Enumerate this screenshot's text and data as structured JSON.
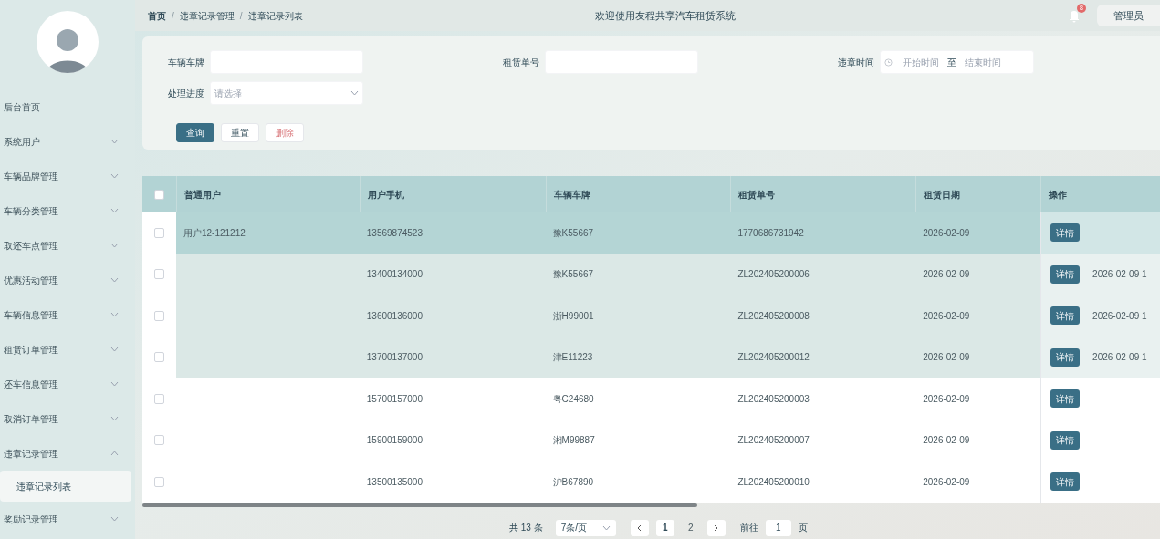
{
  "sidebar": {
    "items": [
      {
        "label": "后台首页",
        "has_children": false
      },
      {
        "label": "系统用户",
        "has_children": true,
        "expanded": false
      },
      {
        "label": "车辆品牌管理",
        "has_children": true,
        "expanded": false
      },
      {
        "label": "车辆分类管理",
        "has_children": true,
        "expanded": false
      },
      {
        "label": "取还车点管理",
        "has_children": true,
        "expanded": false
      },
      {
        "label": "优惠活动管理",
        "has_children": true,
        "expanded": false
      },
      {
        "label": "车辆信息管理",
        "has_children": true,
        "expanded": false
      },
      {
        "label": "租赁订单管理",
        "has_children": true,
        "expanded": false
      },
      {
        "label": "还车信息管理",
        "has_children": true,
        "expanded": false
      },
      {
        "label": "取消订单管理",
        "has_children": true,
        "expanded": false
      },
      {
        "label": "违章记录管理",
        "has_children": true,
        "expanded": true,
        "children": [
          {
            "label": "违章记录列表",
            "selected": true
          }
        ]
      },
      {
        "label": "奖励记录管理",
        "has_children": true,
        "expanded": false
      }
    ]
  },
  "breadcrumb": [
    {
      "label": "首页"
    },
    {
      "separator": "/",
      "label": "违章记录管理"
    },
    {
      "separator": "/",
      "label": "违章记录列表"
    }
  ],
  "header": {
    "title": "欢迎使用友程共享汽车租赁系统",
    "notification_count": "8",
    "user": "管理员"
  },
  "filters": {
    "plate_label": "车辆车牌",
    "order_label": "租赁单号",
    "time_label": "违章时间",
    "start_placeholder": "开始时间",
    "range_separator": "至",
    "end_placeholder": "结束时间",
    "progress_label": "处理进度",
    "progress_placeholder": "请选择"
  },
  "buttons": [
    {
      "label": "查询",
      "kind": "primary"
    },
    {
      "label": "重置",
      "kind": "default"
    },
    {
      "label": "删除",
      "kind": "danger"
    }
  ],
  "table": {
    "all_checked": false,
    "columns": [
      "普通用户",
      "用户手机",
      "车辆车牌",
      "租赁单号",
      "租赁日期",
      "操作"
    ],
    "rows": [
      {
        "checked": false,
        "highlighted": true,
        "user": "用户12-121212",
        "phone": "13569874523",
        "plate": "豫K55667",
        "order": "1770686731942",
        "date": "2026-02-09",
        "action": "详情"
      },
      {
        "checked": false,
        "highlighted": false,
        "phone": "13400134000",
        "plate": "豫K55667",
        "order": "ZL202405200006",
        "date": "2026-02-09",
        "action": "详情",
        "column_7": "2026-02-09 1"
      },
      {
        "checked": false,
        "highlighted": false,
        "phone": "13600136000",
        "plate": "浙H99001",
        "order": "ZL202405200008",
        "date": "2026-02-09",
        "action": "详情",
        "column_7": "2026-02-09 1"
      },
      {
        "checked": false,
        "highlighted": false,
        "phone": "13700137000",
        "plate": "津E11223",
        "order": "ZL202405200012",
        "date": "2026-02-09",
        "action": "详情",
        "column_7": "2026-02-09 1"
      },
      {
        "checked": false,
        "highlighted": false,
        "phone": "15700157000",
        "plate": "粤C24680",
        "order": "ZL202405200003",
        "date": "2026-02-09",
        "action": "详情"
      },
      {
        "checked": false,
        "highlighted": false,
        "phone": "15900159000",
        "plate": "湘M99887",
        "order": "ZL202405200007",
        "date": "2026-02-09",
        "action": "详情"
      },
      {
        "checked": false,
        "highlighted": false,
        "phone": "13500135000",
        "plate": "沪B67890",
        "order": "ZL202405200010",
        "date": "2026-02-09",
        "action": "详情"
      }
    ]
  },
  "pagination": {
    "total": "共 13 条",
    "page_size": "7条/页",
    "pages": [
      {
        "label": "1",
        "selected": true
      },
      {
        "label": "2",
        "selected": false
      }
    ],
    "goto_label": "前往",
    "goto_value": "1",
    "page_suffix": "页"
  }
}
